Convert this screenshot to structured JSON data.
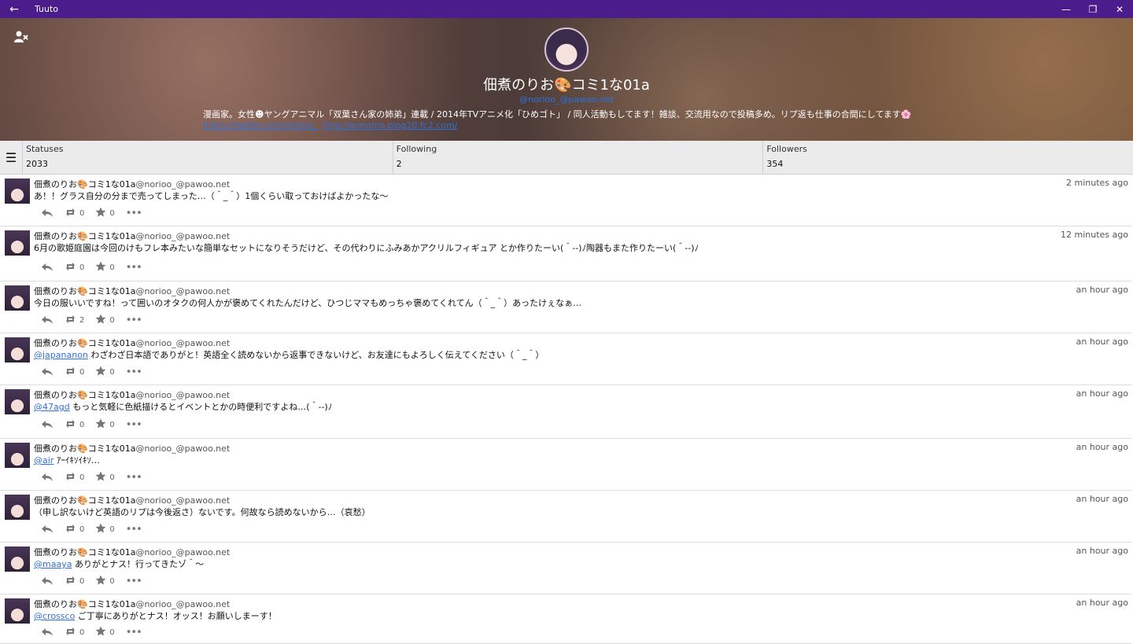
{
  "window": {
    "title": "Tuuto"
  },
  "profile": {
    "display_name": "佃煮のりお🎨コミ1な01a",
    "handle": "@norioo_@pawoo.net",
    "bio": "漫画家。女性☻ヤングアニマル「双葉さん家の姉弟」連載 / 2014年TVアニメ化「ひめゴト」 / 同人活動もしてます！雑談、交流用なので投稿多め。リプ返も仕事の合間にしてます🌸",
    "link1": "https://twitter.com/norioo_",
    "link2": "http://armomo.blog20.fc2.com/"
  },
  "stats": {
    "statuses_label": "Statuses",
    "statuses": "2033",
    "following_label": "Following",
    "following": "2",
    "followers_label": "Followers",
    "followers": "354"
  },
  "posts": [
    {
      "name": "佃煮のりお🎨コミ1な01a",
      "acct": "@norioo_@pawoo.net",
      "time": "2 minutes ago",
      "mention": "",
      "text": "あ！！グラス自分の分まで売ってしまった…（＾_＾）1個くらい取っておけばよかったな～",
      "reblogs": "0",
      "favs": "0"
    },
    {
      "name": "佃煮のりお🎨コミ1な01a",
      "acct": "@norioo_@pawoo.net",
      "time": "12 minutes ago",
      "mention": "",
      "text": "6月の歌姫庭園は今回のけもフレ本みたいな簡単なセットになりそうだけど、その代わりにふみあかアクリルフィギュア とか作りたーい(＾--)ﾉ陶器もまた作りたーい(＾--)ﾉ",
      "reblogs": "0",
      "favs": "0"
    },
    {
      "name": "佃煮のりお🎨コミ1な01a",
      "acct": "@norioo_@pawoo.net",
      "time": "an hour ago",
      "mention": "",
      "text": "今日の服いいですね！って囲いのオタクの何人かが褒めてくれたんだけど、ひつじママもめっちゃ褒めてくれてん（＾_＾）あったけぇなぁ…",
      "reblogs": "2",
      "favs": "0"
    },
    {
      "name": "佃煮のりお🎨コミ1な01a",
      "acct": "@norioo_@pawoo.net",
      "time": "an hour ago",
      "mention": "@japananon",
      "text": " わざわざ日本語でありがと！英語全く読めないから返事できないけど、お友達にもよろしく伝えてください（＾_＾）",
      "reblogs": "0",
      "favs": "0"
    },
    {
      "name": "佃煮のりお🎨コミ1な01a",
      "acct": "@norioo_@pawoo.net",
      "time": "an hour ago",
      "mention": "@47agd",
      "text": " もっと気軽に色紙描けるとイベントとかの時便利ですよね…(＾--)ﾉ",
      "reblogs": "0",
      "favs": "0"
    },
    {
      "name": "佃煮のりお🎨コミ1な01a",
      "acct": "@norioo_@pawoo.net",
      "time": "an hour ago",
      "mention": "@air",
      "text": " ｱｰｲｷｿｲｷｿ…",
      "reblogs": "0",
      "favs": "0"
    },
    {
      "name": "佃煮のりお🎨コミ1な01a",
      "acct": "@norioo_@pawoo.net",
      "time": "an hour ago",
      "mention": "",
      "text": "（申し訳ないけど英語のリプは今後返さ）ないです。何故なら読めないから…（哀愁）",
      "reblogs": "0",
      "favs": "0"
    },
    {
      "name": "佃煮のりお🎨コミ1な01a",
      "acct": "@norioo_@pawoo.net",
      "time": "an hour ago",
      "mention": "@maaya",
      "text": " ありがとナス！行ってきたゾ＾～",
      "reblogs": "0",
      "favs": "0"
    },
    {
      "name": "佃煮のりお🎨コミ1な01a",
      "acct": "@norioo_@pawoo.net",
      "time": "an hour ago",
      "mention": "@crossco",
      "text": " ご丁寧にありがとナス！オッス！お願いしまーす！",
      "reblogs": "0",
      "favs": "0"
    }
  ]
}
